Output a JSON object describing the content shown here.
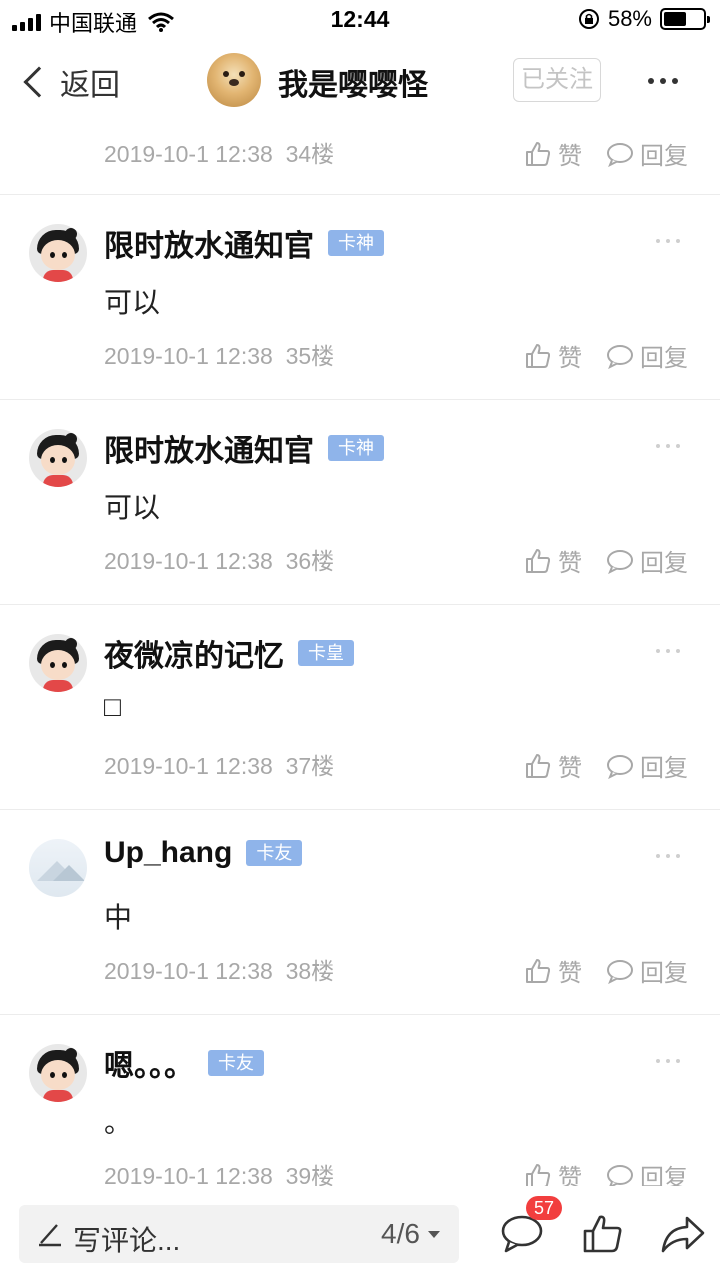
{
  "status_bar": {
    "carrier": "中国联通",
    "time": "12:44",
    "battery_percent": "58%",
    "battery_level": 0.58
  },
  "header": {
    "back_label": "返回",
    "title": "我是嘤嘤怪",
    "follow_label": "已关注"
  },
  "top_partial": {
    "date": "2019-10-1 12:38",
    "floor": "34楼",
    "like_label": "赞",
    "reply_label": "回复"
  },
  "posts": [
    {
      "username": "限时放水通知官",
      "badge": "卡神",
      "content": "可以",
      "date": "2019-10-1 12:38",
      "floor": "35楼",
      "like_label": "赞",
      "reply_label": "回复",
      "avatar": "cartoon-girl"
    },
    {
      "username": "限时放水通知官",
      "badge": "卡神",
      "content": "可以",
      "date": "2019-10-1 12:38",
      "floor": "36楼",
      "like_label": "赞",
      "reply_label": "回复",
      "avatar": "cartoon-girl"
    },
    {
      "username": "夜微凉的记忆",
      "badge": "卡皇",
      "content": "□",
      "date": "2019-10-1 12:38",
      "floor": "37楼",
      "like_label": "赞",
      "reply_label": "回复",
      "avatar": "cartoon-girl"
    },
    {
      "username": "Up_hang",
      "badge": "卡友",
      "content": "中",
      "date": "2019-10-1 12:38",
      "floor": "38楼",
      "like_label": "赞",
      "reply_label": "回复",
      "avatar": "scenery"
    },
    {
      "username": "嗯。。。",
      "badge": "卡友",
      "content": "。",
      "date": "2019-10-1 12:38",
      "floor": "39楼",
      "like_label": "赞",
      "reply_label": "回复",
      "avatar": "cartoon-girl"
    }
  ],
  "bottom_bar": {
    "comment_placeholder": "写评论...",
    "page_indicator": "4/6",
    "comment_count": "57"
  },
  "colors": {
    "badge": "#8fb4ea",
    "notification": "#f23e3e",
    "meta_text": "#a8a8a8"
  }
}
